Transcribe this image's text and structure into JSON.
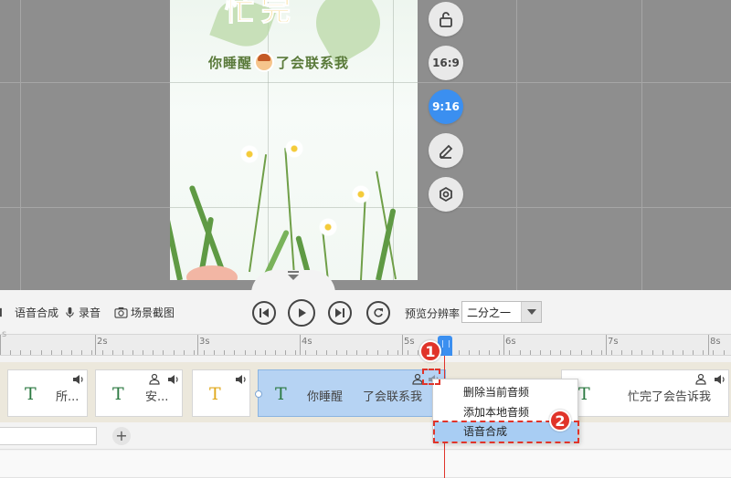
{
  "canvas": {
    "poster_title": "忙完",
    "poster_subtitle_left": "你睡醒",
    "poster_subtitle_right": "了会联系我"
  },
  "side_buttons": [
    {
      "name": "lock",
      "label": ""
    },
    {
      "name": "ratio-16-9",
      "label": "16:9"
    },
    {
      "name": "ratio-9-16",
      "label": "9:16"
    },
    {
      "name": "edit",
      "label": ""
    },
    {
      "name": "settings",
      "label": ""
    }
  ],
  "toolbar": {
    "tts_label": "语音合成",
    "record_label": "录音",
    "screenshot_label": "场景截图",
    "resolution_label": "预览分辨率",
    "resolution_value": "二分之一"
  },
  "ruler": {
    "ticks": [
      "2s",
      "3s",
      "4s",
      "5s",
      "6s",
      "7s",
      "8s"
    ]
  },
  "clips": [
    {
      "text": "所..."
    },
    {
      "text": "安..."
    },
    {
      "text": ""
    },
    {
      "text_left": "你睡醒",
      "text_right": "了会联系我"
    },
    {
      "text": "忙完了会告诉我"
    }
  ],
  "context_menu": {
    "items": [
      "删除当前音频",
      "添加本地音频",
      "语音合成"
    ]
  },
  "annotations": {
    "badge_1": "1",
    "badge_2": "2"
  },
  "colors": {
    "accent": "#3b8ff0",
    "annotation": "#e0342a",
    "highlight": "#a8cdf3"
  }
}
